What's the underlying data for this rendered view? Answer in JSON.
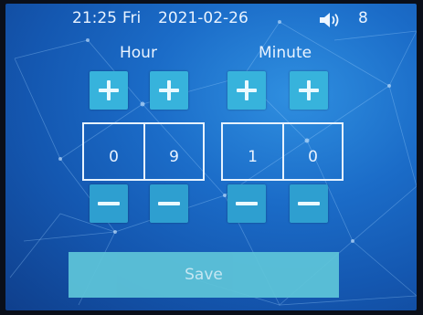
{
  "status_bar": {
    "time": "21:25",
    "day": "Fri",
    "date": "2021-02-26",
    "volume_icon": "speaker-volume-icon",
    "volume_level": "8"
  },
  "labels": {
    "hour": "Hour",
    "minute": "Minute"
  },
  "digits": {
    "hour_tens": "0",
    "hour_ones": "9",
    "minute_tens": "1",
    "minute_ones": "0"
  },
  "buttons": {
    "plus_icon": "plus-icon",
    "minus_icon": "minus-icon",
    "save_label": "Save"
  },
  "colors": {
    "background": "#1b6cc8",
    "button": "#37b3dc",
    "save_button": "#5ec5d9",
    "text": "#e9f3ff"
  }
}
